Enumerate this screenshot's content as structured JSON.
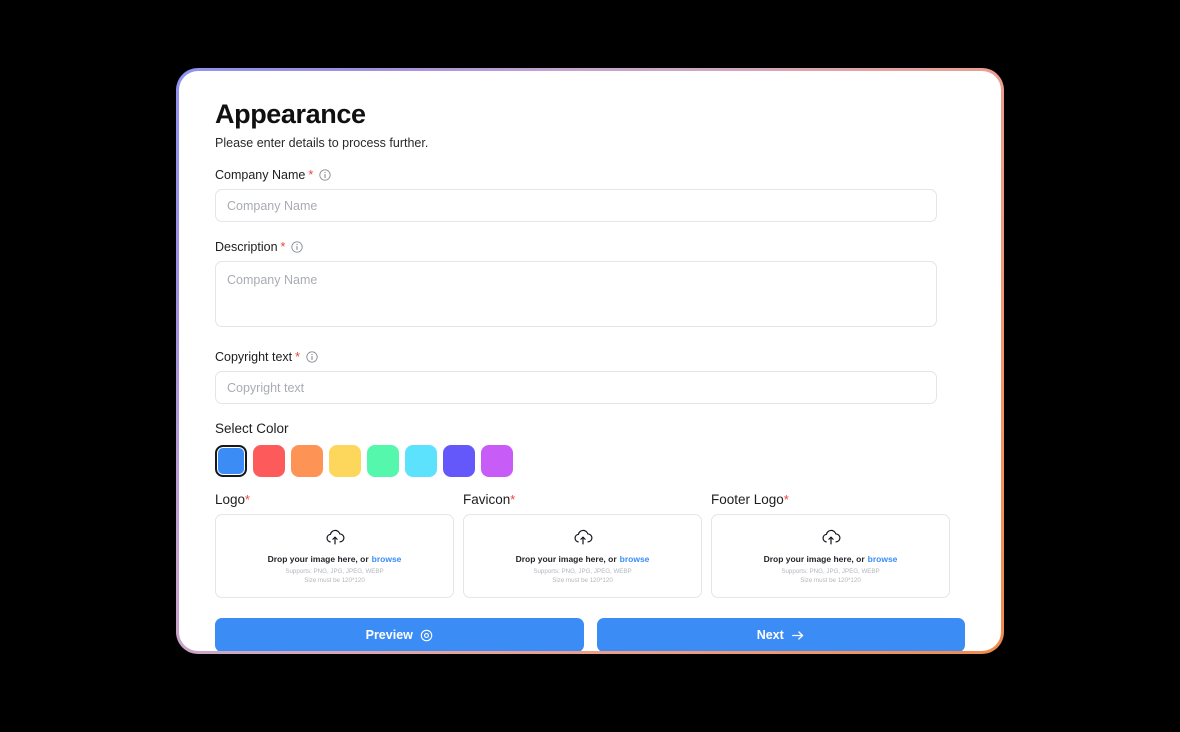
{
  "page": {
    "title": "Appearance",
    "subtitle": "Please enter details to process further."
  },
  "fields": {
    "company_name": {
      "label": "Company Name",
      "required_mark": "*",
      "placeholder": "Company Name",
      "value": ""
    },
    "description": {
      "label": "Description",
      "required_mark": "*",
      "placeholder": "Company Name",
      "value": ""
    },
    "copyright_text": {
      "label": "Copyright text",
      "required_mark": "*",
      "placeholder": "Copyright text",
      "value": ""
    }
  },
  "color_picker": {
    "label": "Select Color",
    "selected_index": 0,
    "swatches": [
      {
        "name": "blue",
        "hex": "#3b8cf5",
        "selected": true
      },
      {
        "name": "red",
        "hex": "#fd5b5b",
        "selected": false
      },
      {
        "name": "orange",
        "hex": "#fd9355",
        "selected": false
      },
      {
        "name": "yellow",
        "hex": "#fdd75c",
        "selected": false
      },
      {
        "name": "mint",
        "hex": "#54f7ab",
        "selected": false
      },
      {
        "name": "cyan",
        "hex": "#5ce2fd",
        "selected": false
      },
      {
        "name": "indigo",
        "hex": "#6458fa",
        "selected": false
      },
      {
        "name": "magenta",
        "hex": "#c75cf7",
        "selected": false
      }
    ]
  },
  "uploads": {
    "drop_text": "Drop your image here, or",
    "browse_text": "browse",
    "supports_text": "Supports: PNG, JPG, JPEG, WEBP",
    "size_text": "Size must be 120*120",
    "items": [
      {
        "label": "Logo",
        "required_mark": "*"
      },
      {
        "label": "Favicon",
        "required_mark": "*"
      },
      {
        "label": "Footer Logo",
        "required_mark": "*"
      }
    ]
  },
  "actions": {
    "preview_label": "Preview",
    "next_label": "Next"
  },
  "theme": {
    "accent": "#3b8cf5",
    "required_color": "#f0423c",
    "frame_gradient_start": "#8f93f0",
    "frame_gradient_end": "#ef8a4e"
  }
}
